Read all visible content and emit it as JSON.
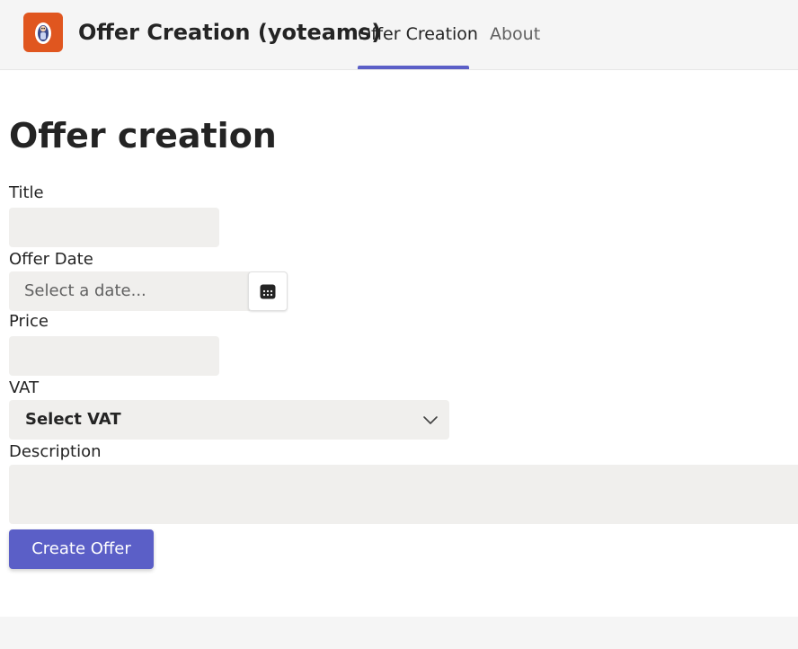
{
  "header": {
    "app_title": "Offer Creation (yoteams)",
    "logo_icon": "yoteams-logo-icon",
    "brand_color": "#e0561f",
    "tabs": [
      {
        "label": "Offer Creation",
        "active": true
      },
      {
        "label": "About",
        "active": false
      }
    ],
    "accent_color": "#5b5fc7"
  },
  "main": {
    "page_title": "Offer creation",
    "fields": {
      "title": {
        "label": "Title",
        "value": ""
      },
      "offer_date": {
        "label": "Offer Date",
        "placeholder": "Select a date...",
        "icon": "calendar-icon"
      },
      "price": {
        "label": "Price",
        "value": ""
      },
      "vat": {
        "label": "VAT",
        "selected": "Select VAT",
        "icon": "chevron-down-icon"
      },
      "description": {
        "label": "Description",
        "value": ""
      }
    },
    "submit_label": "Create Offer"
  }
}
